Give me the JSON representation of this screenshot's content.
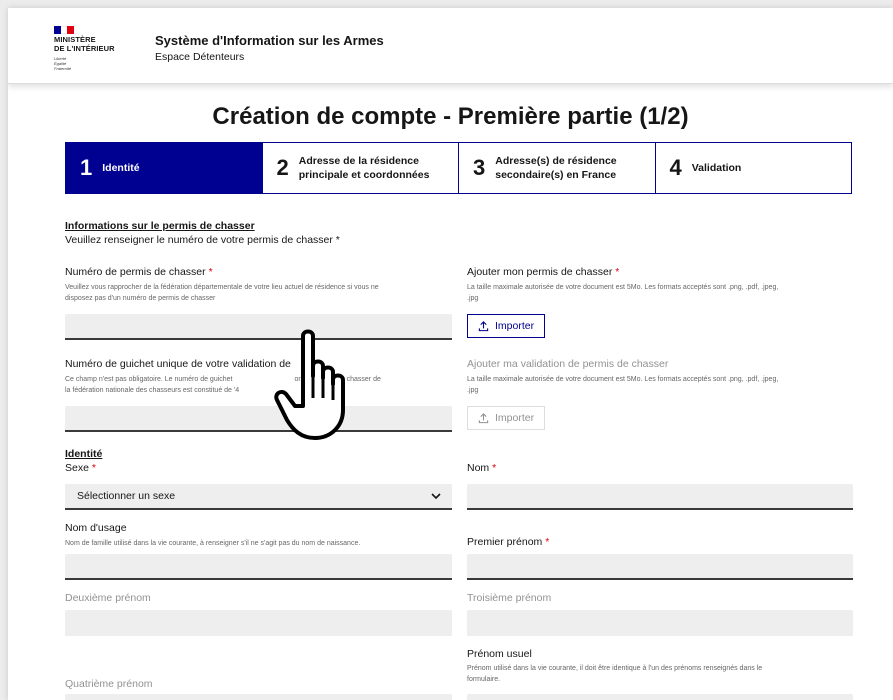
{
  "header": {
    "flag_colors": [
      "#000091",
      "#ffffff",
      "#e1000f"
    ],
    "logo_lines": [
      "MINISTÈRE",
      "DE L'INTÉRIEUR"
    ],
    "logo_motto": [
      "Liberté",
      "Égalité",
      "Fraternité"
    ],
    "service_title": "Système d'Information sur les Armes",
    "service_subtitle": "Espace Détenteurs"
  },
  "page_title": "Création de compte - Première partie (1/2)",
  "stepper": [
    {
      "num": "1",
      "label1": "Identité",
      "label2": "",
      "active": true
    },
    {
      "num": "2",
      "label1": "Adresse de la résidence",
      "label2": "principale et coordonnées",
      "active": false
    },
    {
      "num": "3",
      "label1": "Adresse(s) de résidence",
      "label2": "secondaire(s) en France",
      "active": false
    },
    {
      "num": "4",
      "label1": "Validation",
      "label2": "",
      "active": false
    }
  ],
  "permis": {
    "section_title": "Informations sur le permis de chasser",
    "intro": "Veuillez renseigner le numéro de votre permis de chasser *",
    "numero_label": "Numéro de permis de chasser",
    "numero_hint1": "Veuillez vous rapprocher de la fédération départementale de votre lieu actuel de résidence si vous ne",
    "numero_hint2": "disposez pas d'un numéro de permis de chasser",
    "upload_label": "Ajouter mon permis de chasser",
    "upload_hint1": "La taille maximale autorisée de votre document est 5Mo. Les formats acceptés sont .png, .pdf, .jpeg,",
    "upload_hint2": ".jpg",
    "import_label": "Importer",
    "guichet_label": "Numéro de guichet unique de votre validation de",
    "guichet_hint1": "Ce champ n'est pas obligatoire. Le numéro de guichet",
    "guichet_hint1b": "on de permis de chasser de",
    "guichet_hint2": "la fédération nationale des chasseurs est constitué de '4",
    "validation_label": "Ajouter ma validation de permis de chasser",
    "validation_hint1": "La taille maximale autorisée de votre document est 5Mo. Les formats acceptés sont .png, .pdf, .jpeg,",
    "validation_hint2": ".jpg",
    "import2_label": "Importer"
  },
  "identite": {
    "section_title": "Identité",
    "sexe_label": "Sexe",
    "sexe_value": "Sélectionner un sexe",
    "nom_label": "Nom",
    "nom_usage_label": "Nom d'usage",
    "nom_usage_hint": "Nom de famille utilisé dans la vie courante, à renseigner s'il ne s'agit pas du nom de naissance.",
    "prenom1_label": "Premier prénom",
    "prenom2_label": "Deuxième prénom",
    "prenom3_label": "Troisième prénom",
    "prenom_usuel_label": "Prénom usuel",
    "prenom_usuel_hint1": "Prénom utilisé dans la vie courante, il doit être identique à l'un des prénoms renseignés dans le",
    "prenom_usuel_hint2": "formulaire.",
    "prenom4_label": "Quatrième prénom"
  },
  "required_marker": "*"
}
